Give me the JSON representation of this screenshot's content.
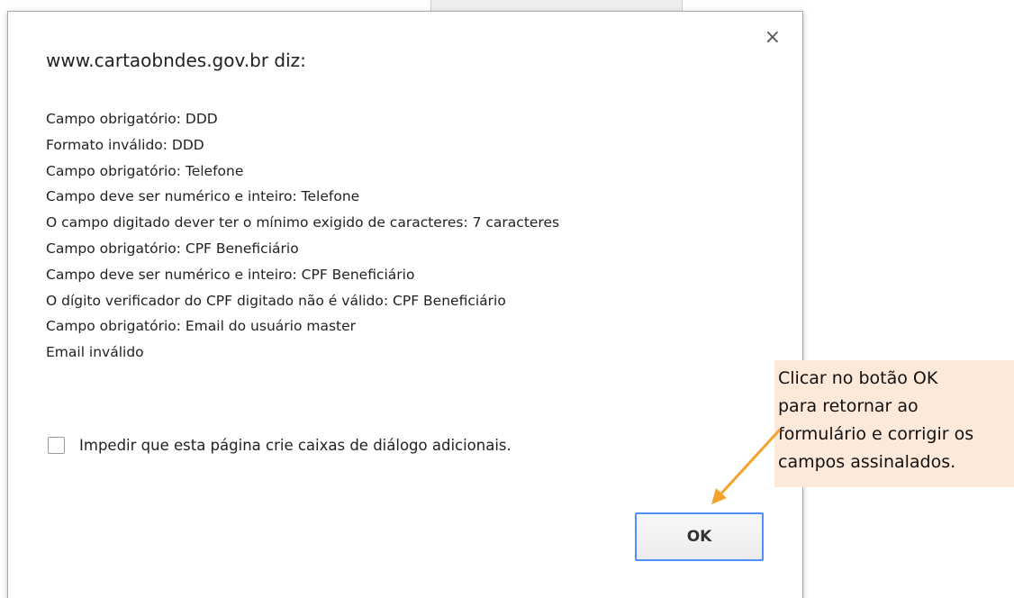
{
  "dialog": {
    "title": "www.cartaobndes.gov.br diz:",
    "close_symbol": "×",
    "messages": [
      "Campo obrigatório: DDD",
      "Formato inválido: DDD",
      "Campo obrigatório: Telefone",
      "Campo deve ser numérico e inteiro: Telefone",
      "O campo digitado dever ter o mínimo exigido de caracteres: 7 caracteres",
      "Campo obrigatório: CPF Beneficiário",
      "Campo deve ser numérico e inteiro: CPF Beneficiário",
      "O dígito verificador do CPF digitado não é válido:  CPF Beneficiário",
      "Campo obrigatório: Email do usuário master",
      "Email inválido"
    ],
    "suppress_checkbox": {
      "label": "Impedir que esta página crie caixas de diálogo adicionais.",
      "checked": false
    },
    "ok_label": "OK"
  },
  "annotation": {
    "lines": [
      "Clicar no botão OK",
      "para retornar ao",
      "formulário e corrigir os",
      "campos assinalados."
    ],
    "background_color": "#fde9d9",
    "arrow_color": "#f4a22d"
  },
  "colors": {
    "ok_border": "#4d90fe"
  }
}
